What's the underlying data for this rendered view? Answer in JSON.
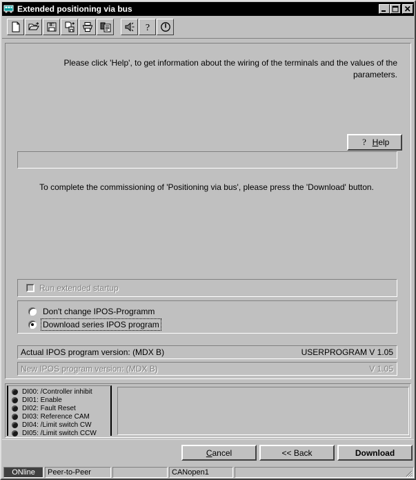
{
  "window": {
    "title": "Extended positioning via bus",
    "icon": "bus-icon",
    "controls": {
      "minimize": "minimize-icon",
      "maximize": "maximize-icon",
      "close": "close-icon"
    }
  },
  "toolbar": {
    "buttons": [
      {
        "name": "new-file-icon",
        "tooltip": "New"
      },
      {
        "name": "open-folder-icon",
        "tooltip": "Open"
      },
      {
        "name": "save-disk-icon",
        "tooltip": "Save"
      },
      {
        "name": "save-as-icon",
        "tooltip": "Save As"
      },
      {
        "name": "print-icon",
        "tooltip": "Print"
      },
      {
        "name": "copy-document-icon",
        "tooltip": "Copy"
      },
      {
        "name": "speaker-icon",
        "tooltip": "Sound"
      },
      {
        "name": "help-question-icon",
        "tooltip": "Help"
      },
      {
        "name": "power-icon",
        "tooltip": "Power"
      }
    ]
  },
  "main": {
    "instruction_top": "Please click 'Help', to get information about the wiring of the terminals and the values of the parameters.",
    "help_button": {
      "label_pre": "",
      "label_accel": "H",
      "label_post": "elp",
      "icon": "question-mark-icon"
    },
    "status_field_value": "",
    "instruction_bottom": "To complete the commissioning of 'Positioning via bus', please press the 'Download' button.",
    "extended_startup": {
      "label": "Run extended startup",
      "checked": false,
      "enabled": false
    },
    "program_options": [
      {
        "label": "Don't change IPOS-Programm",
        "selected": false,
        "focused": false
      },
      {
        "label": "Download series IPOS program",
        "selected": true,
        "focused": true
      }
    ],
    "versions": [
      {
        "label": "Actual IPOS program version: (MDX B)",
        "value": "USERPROGRAM V  1.05",
        "enabled": true
      },
      {
        "label": "New IPOS program version: (MDX B)",
        "value": "V  1.05",
        "enabled": false
      }
    ]
  },
  "digital_inputs": [
    {
      "id": "DI00",
      "label": "DI00: /Controller inhibit",
      "state": "off"
    },
    {
      "id": "DI01",
      "label": "DI01: Enable",
      "state": "off"
    },
    {
      "id": "DI02",
      "label": "DI02: Fault Reset",
      "state": "off"
    },
    {
      "id": "DI03",
      "label": "DI03: Reference CAM",
      "state": "off"
    },
    {
      "id": "DI04",
      "label": "DI04: /Limit switch CW",
      "state": "off"
    },
    {
      "id": "DI05",
      "label": "DI05: /Limit switch CCW",
      "state": "off"
    }
  ],
  "dialog_buttons": {
    "cancel": {
      "accel": "C",
      "rest": "ancel"
    },
    "back": "<< Back",
    "download": "Download"
  },
  "statusbar": {
    "online": "ONline",
    "mode": "Peer-to-Peer",
    "blank1": "",
    "bus": "CANopen1",
    "blank2": "",
    "grip": "resize-grip-icon"
  },
  "colors": {
    "face": "#c0c0c0",
    "titlebar": "#000000",
    "title_text": "#ffffff",
    "shadow": "#808080",
    "dark_shadow": "#404040",
    "highlight": "#ffffff",
    "text": "#000000",
    "disabled_text": "#808080",
    "status_active_bg": "#404040"
  }
}
